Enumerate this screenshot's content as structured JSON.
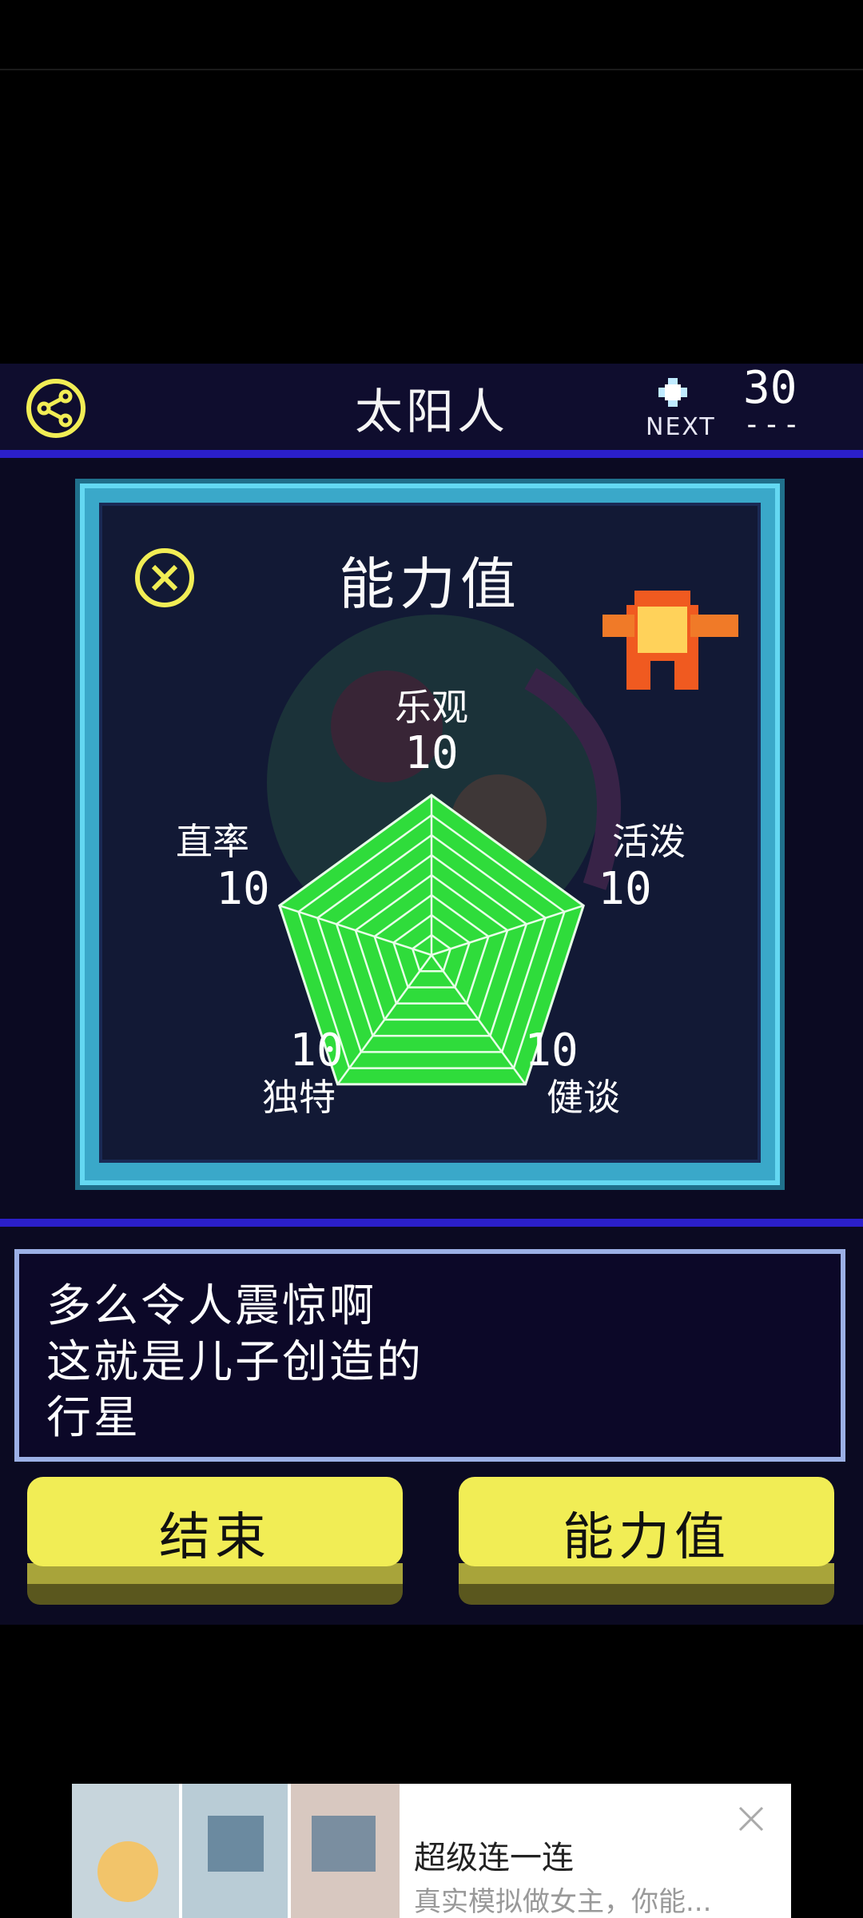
{
  "header": {
    "title": "太阳人",
    "next_label": "NEXT",
    "next_value": "30",
    "next_dash": "---"
  },
  "panel": {
    "title": "能力值",
    "stats": [
      {
        "name": "乐观",
        "value": "10"
      },
      {
        "name": "活泼",
        "value": "10"
      },
      {
        "name": "健谈",
        "value": "10"
      },
      {
        "name": "独特",
        "value": "10"
      },
      {
        "name": "直率",
        "value": "10"
      }
    ]
  },
  "chart_data": {
    "type": "radar",
    "categories": [
      "乐观",
      "活泼",
      "健谈",
      "独特",
      "直率"
    ],
    "values": [
      10,
      10,
      10,
      10,
      10
    ],
    "rlim": [
      0,
      10
    ],
    "fill_color": "#2fdc3b",
    "grid_color": "#e8ffe8"
  },
  "message": {
    "lines": [
      "多么令人震惊啊",
      "这就是儿子创造的",
      "行星"
    ]
  },
  "buttons": {
    "end_label": "结束",
    "stats_label": "能力值"
  },
  "ad": {
    "title": "超级连一连",
    "desc": "真实模拟做女主，你能..."
  },
  "colors": {
    "accent_yellow": "#f1ed55",
    "header_rule": "#2b1fc9",
    "panel_border": "#3aa8c9"
  }
}
